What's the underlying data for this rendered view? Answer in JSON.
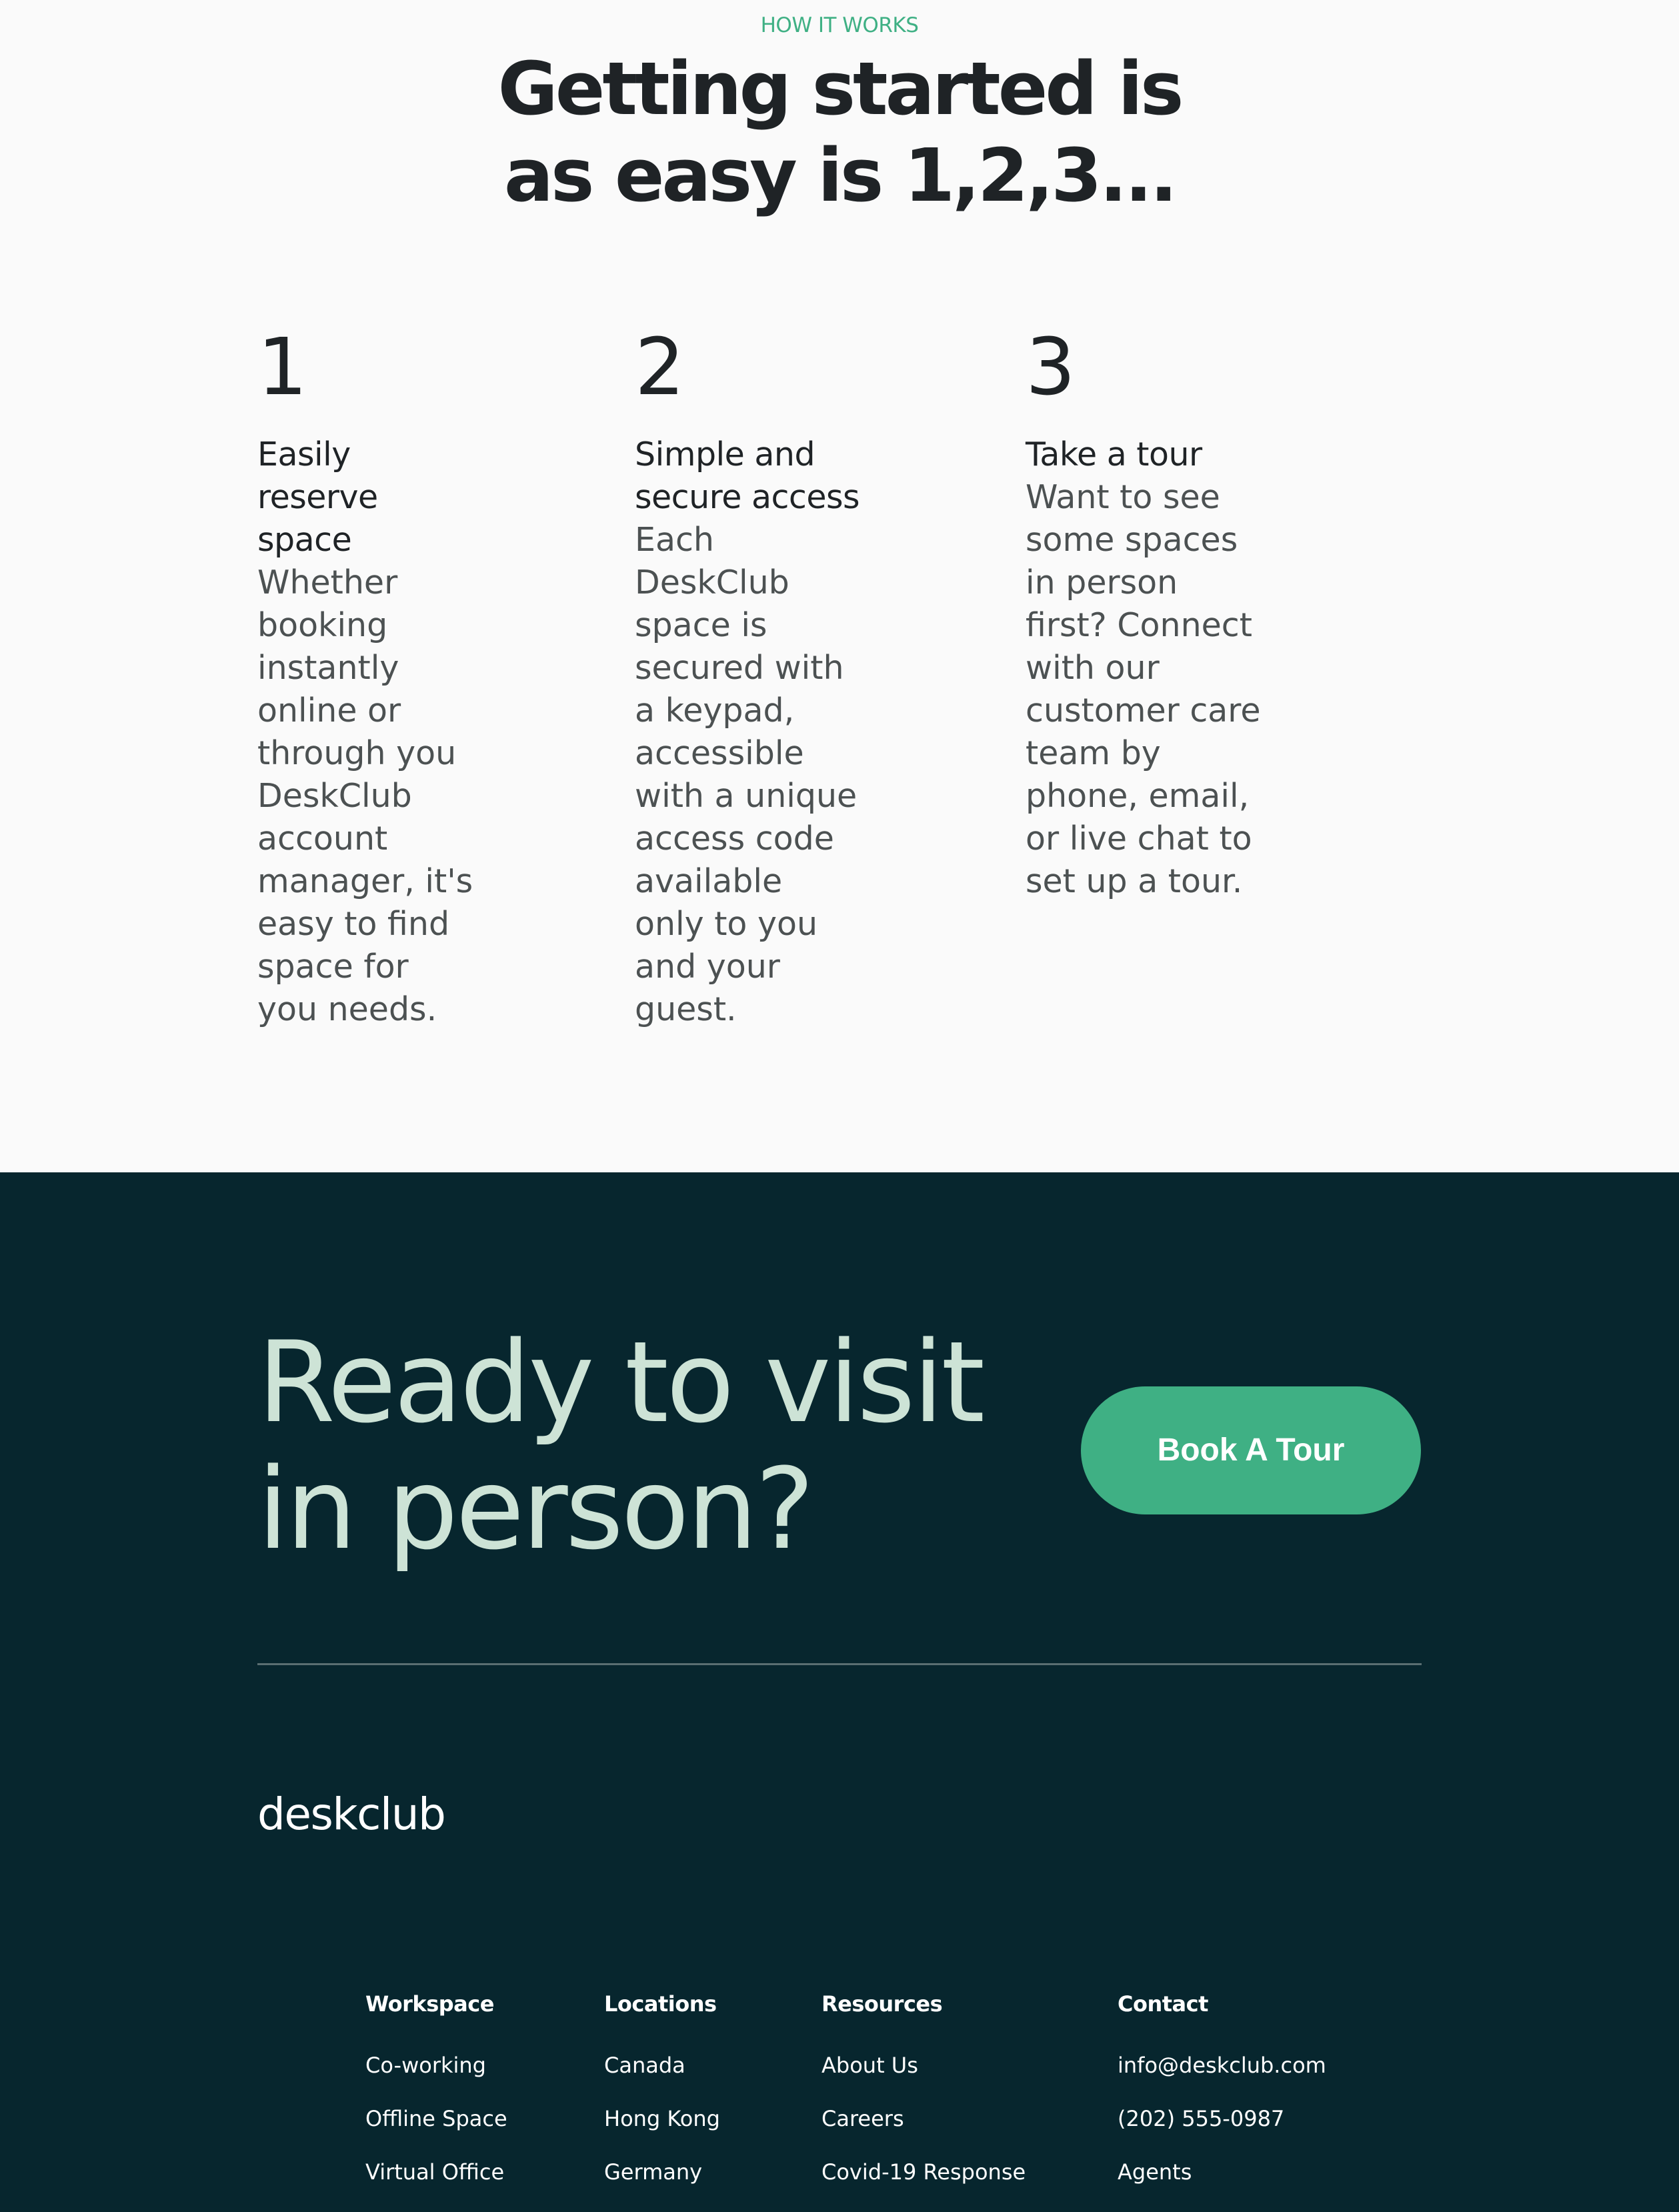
{
  "how_it_works": {
    "eyebrow": "HOW IT WORKS",
    "headline": "Getting started is as easy is 1,2,3...",
    "steps": [
      {
        "number": "1",
        "title": "Easily reserve space",
        "body": "Whether booking instantly online or through you DeskClub account manager, it's easy to find space for you needs."
      },
      {
        "number": "2",
        "title": "Simple and secure access",
        "body": "Each DeskClub space is secured with a keypad, accessible with a unique access code available only to you and your guest."
      },
      {
        "number": "3",
        "title": "Take a tour",
        "body": "Want to see some spaces in person first? Connect with our customer care team by phone, email, or live chat to set up a tour."
      }
    ]
  },
  "cta": {
    "heading": "Ready to visit in person?",
    "button_label": "Book A Tour"
  },
  "footer": {
    "logo": "deskclub",
    "columns": [
      {
        "title": "Workspace",
        "links": [
          "Co-working",
          "Offline Space",
          "Virtual Office"
        ]
      },
      {
        "title": "Locations",
        "links": [
          "Canada",
          "Hong Kong",
          "Germany"
        ]
      },
      {
        "title": "Resources",
        "links": [
          "About Us",
          "Careers",
          "Covid-19 Response"
        ]
      },
      {
        "title": "Contact",
        "links": [
          "info@deskclub.com",
          "(202) 555-0987",
          "Agents"
        ]
      }
    ]
  },
  "colors": {
    "accent": "#3fb084",
    "dark_background": "#07262e",
    "cta_heading": "#cde3d6",
    "light_background": "#fafafa",
    "text_dark": "#1f2326"
  }
}
